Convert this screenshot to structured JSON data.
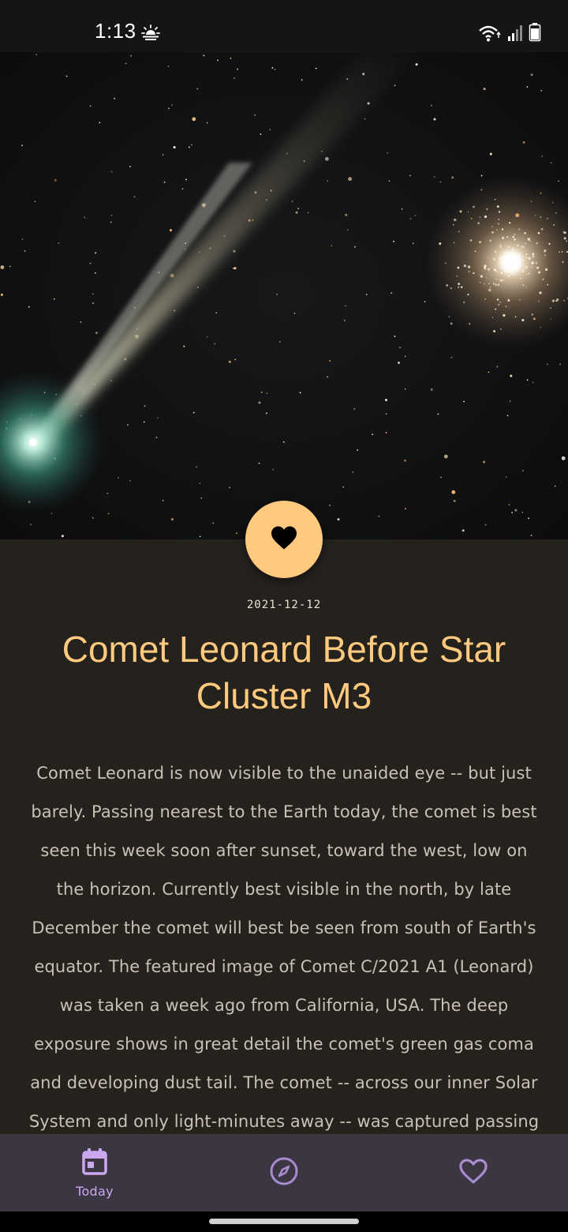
{
  "status_bar": {
    "time": "1:13",
    "weather_icon": "partly-sunny-icon",
    "wifi_icon": "wifi-icon",
    "signal_icon": "signal-icon",
    "battery_icon": "battery-icon"
  },
  "hero": {
    "image": "comet-leonard-star-cluster-photo"
  },
  "favorite": {
    "icon": "heart-icon",
    "color": "#ffc97e"
  },
  "apod": {
    "date": "2021-12-12",
    "title": "Comet Leonard Before Star Cluster M3",
    "explanation": "Comet Leonard is now visible to the unaided eye -- but just barely.  Passing nearest to the Earth today, the comet is best seen this week soon after sunset, toward the west, low on the horizon.  Currently best visible in the north, by late December the comet will best be seen from south of Earth's equator. The featured image of Comet C/2021 A1 (Leonard) was taken a week ago from California, USA. The deep exposure shows in great detail the comet's green gas coma and developing dust tail. The comet -- across our inner Solar System and only light-minutes away -- was captured passing"
  },
  "bottom_nav": {
    "items": [
      {
        "label": "Today",
        "icon": "calendar-icon",
        "active": true
      },
      {
        "label": "",
        "icon": "compass-icon",
        "active": false
      },
      {
        "label": "",
        "icon": "heart-outline-icon",
        "active": false
      }
    ],
    "accent": "#c9a8f0",
    "background": "#3c3542"
  }
}
